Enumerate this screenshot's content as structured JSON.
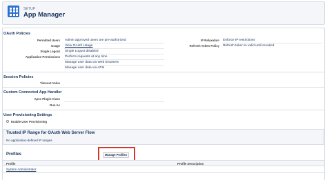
{
  "header": {
    "eyebrow": "SETUP",
    "title": "App Manager"
  },
  "oauth": {
    "title": "OAuth Policies",
    "left": [
      {
        "label": "Permitted Users",
        "value": "Admin approved users are pre-authorized"
      },
      {
        "label": "Usage",
        "value": "View OAuth Usage"
      },
      {
        "label": "Single Logout",
        "value": "Single Logout disabled"
      },
      {
        "label": "Application Permissions",
        "value": "Perform requests at any time"
      }
    ],
    "extra_permissions": [
      "Manage user data via Web browsers",
      "Manage user data via APIs"
    ],
    "right": [
      {
        "label": "IP Relaxation",
        "value": "Enforce IP restrictions"
      },
      {
        "label": "Refresh Token Policy",
        "value": "Refresh token is valid until revoked"
      }
    ]
  },
  "session": {
    "title": "Session Policies",
    "timeout_label": "Timeout Value"
  },
  "custom_handler": {
    "title": "Custom Connected App Handler",
    "apex_label": "Apex Plugin Class",
    "runas_label": "Run As"
  },
  "provisioning": {
    "title": "User Provisioning Settings",
    "enable_label": "Enable User Provisioning"
  },
  "trusted_ip": {
    "title": "Trusted IP Range for OAuth Web Server Flow",
    "empty_text": "No application-defined IP ranges"
  },
  "profiles": {
    "title": "Profiles",
    "manage_button": "Manage Profiles",
    "columns": [
      "Profile",
      "Profile Description"
    ],
    "rows": [
      {
        "profile": "System Administrator"
      }
    ]
  },
  "colors": {
    "accent": "#2d6fd2",
    "highlight": "#d9362b"
  }
}
